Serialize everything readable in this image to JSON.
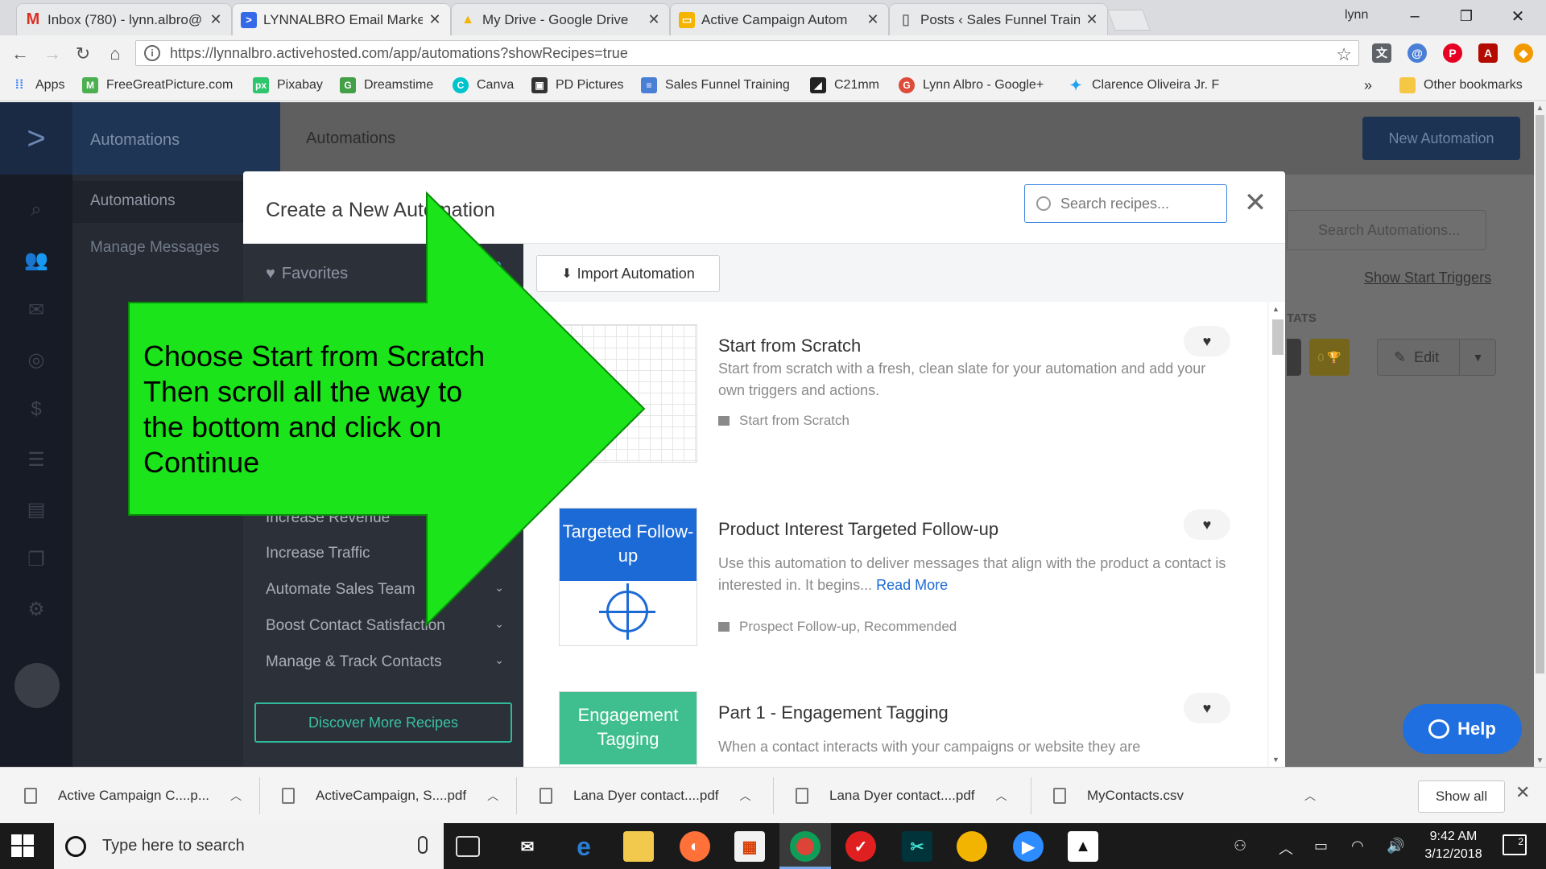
{
  "browser": {
    "tabs": [
      {
        "title": "Inbox (780) - lynn.albro@",
        "favicon": "gmail-icon",
        "color": "#d93025",
        "glyph": "M",
        "close": "✕"
      },
      {
        "title": "LYNNALBRO Email Marke",
        "favicon": "activecampaign-icon",
        "color": "#356ae6",
        "glyph": ">",
        "close": "✕"
      },
      {
        "title": "My Drive - Google Drive",
        "favicon": "google-drive-icon",
        "color": "#f4b400",
        "glyph": "▲",
        "close": "✕"
      },
      {
        "title": "Active Campaign Autom",
        "favicon": "slides-icon",
        "color": "#f4b400",
        "glyph": "▭",
        "close": "✕"
      },
      {
        "title": "Posts ‹ Sales Funnel Train",
        "favicon": "page-icon",
        "color": "#9aa0a6",
        "glyph": "▯",
        "close": "✕"
      }
    ],
    "user": "lynn",
    "url": "https://lynnalbro.activehosted.com/app/automations?showRecipes=true",
    "bookmarks": [
      {
        "label": "Apps",
        "icon": "apps-grid-icon",
        "color": "#4285f4"
      },
      {
        "label": "FreeGreatPicture.com",
        "icon": "freegreatpicture-icon",
        "color": "#4caf50"
      },
      {
        "label": "Pixabay",
        "icon": "pixabay-icon",
        "color": "#2ec66d"
      },
      {
        "label": "Dreamstime",
        "icon": "dreamstime-icon",
        "color": "#43a047"
      },
      {
        "label": "Canva",
        "icon": "canva-icon",
        "color": "#00c4cc"
      },
      {
        "label": "PD Pictures",
        "icon": "pd-pictures-icon",
        "color": "#333333"
      },
      {
        "label": "Sales Funnel Training",
        "icon": "sales-funnel-icon",
        "color": "#4a7fd6"
      },
      {
        "label": "C21mm",
        "icon": "c21mm-icon",
        "color": "#222222"
      },
      {
        "label": "Lynn Albro - Google+",
        "icon": "google-plus-icon",
        "color": "#dd4b39"
      },
      {
        "label": "Clarence Oliveira Jr. F",
        "icon": "twitter-icon",
        "color": "#1da1f2"
      }
    ],
    "other_bookmarks": "Other bookmarks",
    "more_bookmarks": "»"
  },
  "app": {
    "topbar_section": "Automations",
    "page_title": "Automations",
    "new_automation": "New Automation",
    "subnav": {
      "selected": "Automations",
      "secondary": "Manage Messages"
    },
    "search_automations": "Search Automations...",
    "show_start_triggers": "Show Start Triggers",
    "stats_label": "TATS",
    "gold_badge": "0 🏆",
    "edit_label": "Edit",
    "help_label": "Help"
  },
  "modal": {
    "title": "Create a New Automation",
    "search_placeholder": "Search recipes...",
    "close": "✕",
    "favorites": "Favorites",
    "categories": [
      {
        "label": "Increase Revenue",
        "has_chevron": false
      },
      {
        "label": "Increase Traffic",
        "has_chevron": false
      },
      {
        "label": "Automate Sales Team",
        "has_chevron": true
      },
      {
        "label": "Boost Contact Satisfaction",
        "has_chevron": true
      },
      {
        "label": "Manage & Track Contacts",
        "has_chevron": true
      }
    ],
    "discover_more": "Discover More Recipes",
    "import_automation": "Import Automation",
    "recipes": [
      {
        "title": "Start from Scratch",
        "description": "Start from scratch with a fresh, clean slate for your automation and add your own triggers and actions.",
        "read_more": "",
        "tags": "Start from Scratch",
        "thumb_style": "grid"
      },
      {
        "title": "Product Interest Targeted Follow-up",
        "description": "Use this automation to deliver messages that align with the product a contact is interested in. It begins...",
        "read_more": "Read More",
        "tags": "Prospect Follow-up, Recommended",
        "thumb_style": "targeted",
        "thumb_label": "Targeted Follow-up",
        "thumb_color": "#1c6ad5"
      },
      {
        "title": "Part 1 - Engagement Tagging",
        "description": "When a contact interacts with your campaigns or website they are",
        "read_more": "",
        "tags": "",
        "thumb_style": "engagement",
        "thumb_label": "Engagement Tagging",
        "thumb_color": "#3fbf8f"
      }
    ]
  },
  "annotation": {
    "text": "Choose Start from Scratch Then scroll all the way to the bottom and click on Continue",
    "lines": [
      "Choose Start from Scratch",
      "Then scroll all the way to",
      "the bottom and click on",
      "Continue"
    ],
    "color": "#1be41b"
  },
  "downloads": {
    "items": [
      "Active Campaign C....p...",
      "ActiveCampaign, S....pdf",
      "Lana Dyer contact....pdf",
      "Lana Dyer contact....pdf",
      "MyContacts.csv"
    ],
    "show_all": "Show all"
  },
  "taskbar": {
    "search_placeholder": "Type here to search",
    "time": "9:42 AM",
    "date": "3/12/2018",
    "notification_count": "2"
  }
}
